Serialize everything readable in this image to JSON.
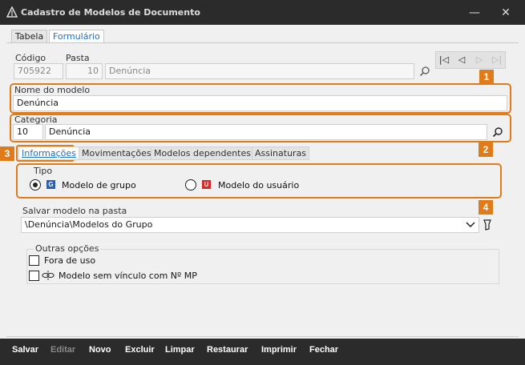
{
  "window": {
    "title": "Cadastro de Modelos de Documento",
    "minimize_glyph": "—",
    "close_glyph": "✕",
    "logo_icon": "app-logo-icon"
  },
  "tabs": [
    "Tabela",
    "Formulário"
  ],
  "codigo": {
    "label": "Código",
    "value": "705922"
  },
  "pasta": {
    "label": "Pasta",
    "number": "10",
    "name": "Denúncia"
  },
  "nome_modelo": {
    "label": "Nome do modelo",
    "value": "Denúncia"
  },
  "categoria": {
    "label": "Categoria",
    "number": "10",
    "name": "Denúncia"
  },
  "subtabs": [
    "Informações",
    "Movimentações",
    "Modelos dependentes",
    "Assinaturas"
  ],
  "tipo": {
    "label": "Tipo",
    "options": [
      {
        "label": "Modelo de grupo",
        "icon_letter": "G",
        "color": "#2f5fb0",
        "selected": true
      },
      {
        "label": "Modelo do usuário",
        "icon_letter": "U",
        "color": "#d42a2a",
        "selected": false
      }
    ]
  },
  "salvar_pasta": {
    "label": "Salvar modelo na pasta",
    "value": "\\Denúncia\\Modelos do Grupo"
  },
  "outras_opcoes": {
    "label": "Outras opções",
    "items": [
      {
        "label": "Fora de uso",
        "checked": false
      },
      {
        "label": "Modelo sem vínculo com Nº MP",
        "checked": false
      }
    ]
  },
  "badges": [
    "1",
    "2",
    "3",
    "4"
  ],
  "toolbar": {
    "salvar": "Salvar",
    "editar": "Editar",
    "novo": "Novo",
    "excluir": "Excluir",
    "limpar": "Limpar",
    "restaurar": "Restaurar",
    "imprimir": "Imprimir",
    "fechar": "Fechar"
  },
  "colors": {
    "accent": "#e07b1a",
    "link": "#1e70c8",
    "titlebar": "#2b2b2b"
  }
}
